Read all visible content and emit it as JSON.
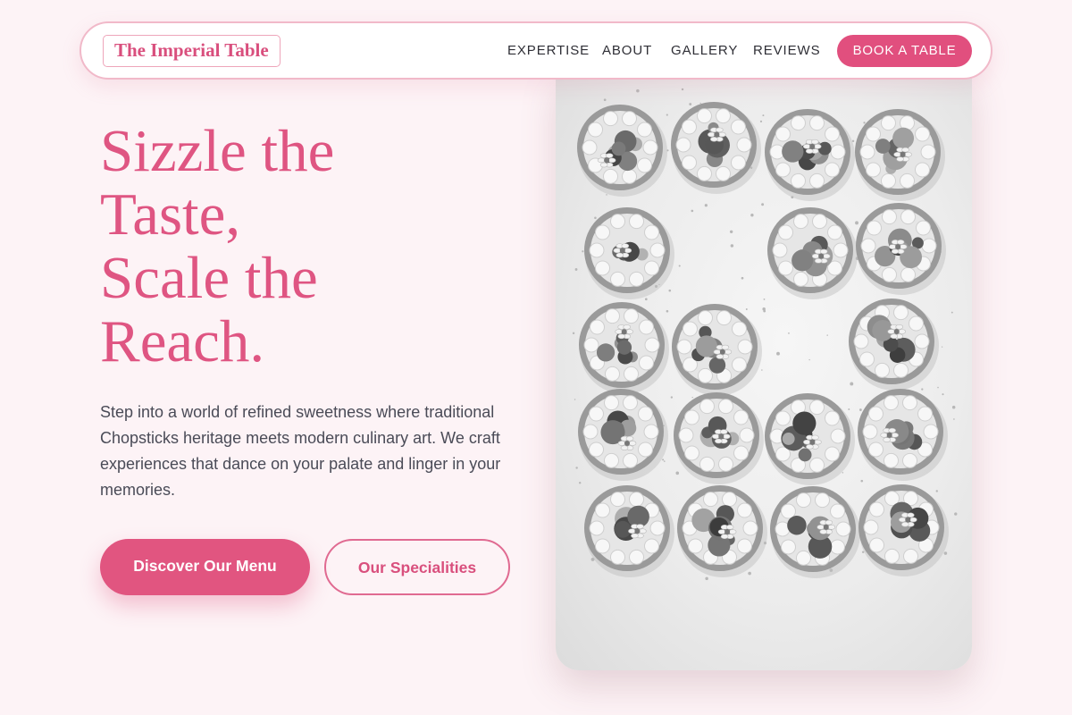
{
  "brand": {
    "name": "The Imperial Table"
  },
  "nav": {
    "links": [
      "EXPERTISE",
      "ABOUT",
      "GALLERY",
      "REVIEWS"
    ],
    "cta": "BOOK A TABLE"
  },
  "hero": {
    "title_lines": [
      "Sizzle the",
      "Taste,",
      "Scale the",
      "Reach."
    ],
    "description": "Step into a world of refined sweetness where traditional Chopsticks heritage meets modern culinary art. We craft experiences that dance on your palate and linger in your memories.",
    "primary_button": "Discover Our Menu",
    "secondary_button": "Our Specialities"
  },
  "image": {
    "subject": "grayscale overhead photo of fruit tarts arranged in a letter shape",
    "tone": "grayscale"
  },
  "colors": {
    "accent": "#e14f7e",
    "accent_text": "#df5582",
    "background": "#fdf3f6",
    "body_text": "#4a4b57",
    "nav_text": "#2f2f36"
  }
}
